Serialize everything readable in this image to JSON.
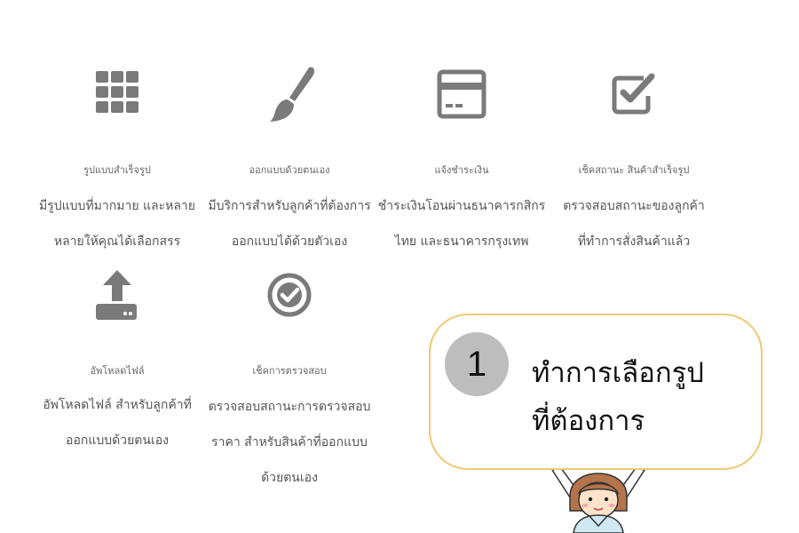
{
  "features": [
    {
      "icon": "grid-icon",
      "title": "รูปแบบสำเร็จรูป",
      "desc_line1": "มีรูปแบบที่มากมาย และหลาย",
      "desc_line2": "หลายให้คุณได้เลือกสรร"
    },
    {
      "icon": "paint-brush-icon",
      "title": "ออกแบบด้วยตนเอง",
      "desc_line1": "มีบริการสำหรับลูกค้าที่ต้องการ",
      "desc_line2": "ออกแบบได้ด้วยตัวเอง"
    },
    {
      "icon": "credit-card-icon",
      "title": "แจ้งชำระเงิน",
      "desc_line1": "ชำระเงินโอนผ่านธนาคารกสิกร",
      "desc_line2": "ไทย และธนาคารกรุงเทพ"
    },
    {
      "icon": "checkbox-icon",
      "title": "เช็คสถานะ สินค้าสำเร็จรูป",
      "desc_line1": "ตรวจสอบสถานะของลูกค้า",
      "desc_line2": "ที่ทำการสั่งสินค้าแล้ว"
    },
    {
      "icon": "upload-icon",
      "title": "อัพโหลดไฟล์",
      "desc_line1": "อัพโหลดไฟล์ สำหรับลูกค้าที่",
      "desc_line2": "ออกแบบด้วยตนเอง"
    },
    {
      "icon": "check-circle-icon",
      "title": "เช็คการตรวจสอบ",
      "desc_line1": "ตรวจสอบสถานะการตรวจสอบ",
      "desc_line2": "ราคา สำหรับสินค้าที่ออกแบบ",
      "desc_line3": "ด้วยตนเอง"
    }
  ],
  "callout": {
    "step_number": "1",
    "line1": "ทำการเลือกรูป",
    "line2": "ที่ต้องการ"
  },
  "colors": {
    "icon": "#7a7a7a",
    "bubble_border": "#f0c875",
    "step_circle": "#bdbdbd"
  }
}
